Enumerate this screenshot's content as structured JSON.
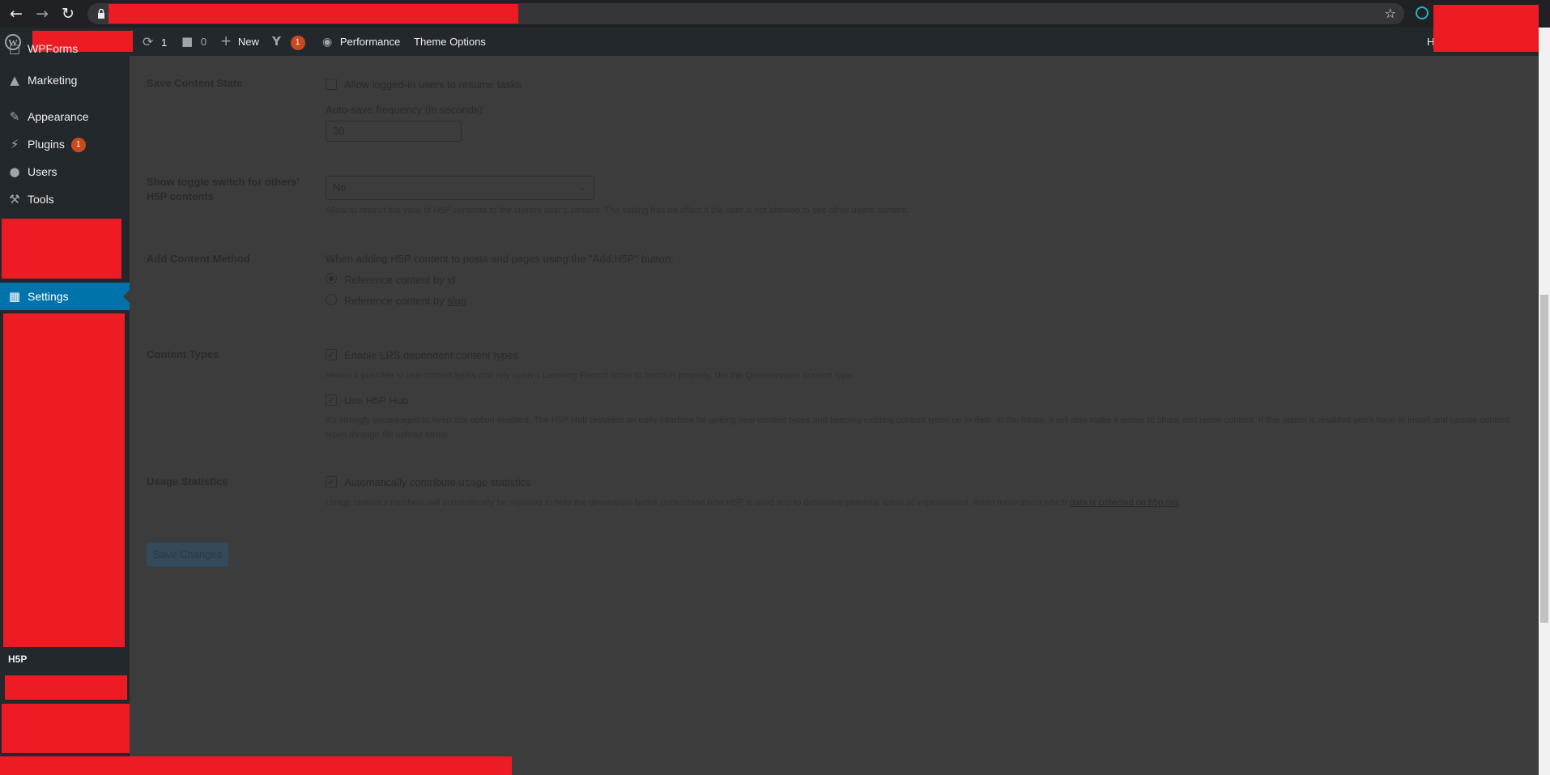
{
  "adminbar": {
    "updates_count": "1",
    "comments_count": "0",
    "new_label": "New",
    "yoast_badge": "1",
    "performance_label": "Performance",
    "theme_options_label": "Theme Options",
    "howdy_partial": "H"
  },
  "sidebar": {
    "items": [
      {
        "label": "WPForms"
      },
      {
        "label": "Marketing"
      },
      {
        "label": "Appearance"
      },
      {
        "label": "Plugins",
        "badge": "1"
      },
      {
        "label": "Users"
      },
      {
        "label": "Tools"
      },
      {
        "label": "Settings"
      },
      {
        "label": "H5P"
      }
    ]
  },
  "settings": {
    "save_state": {
      "label": "Save Content State",
      "checkbox_label": "Allow logged-in users to resume tasks",
      "autosave_label": "Auto-save frequency (in seconds):",
      "autosave_value": "30"
    },
    "toggle_switch": {
      "label": "Show toggle switch for others' H5P contents",
      "select_value": "No",
      "description": "Allow to restrict the view of H5P contents to the current user's content. The setting has no effect if the user is not allowed to see other users' content."
    },
    "content_method": {
      "label": "Add Content Method",
      "intro": "When adding H5P content to posts and pages using the \"Add H5P\" button:",
      "option_id": "Reference content by id",
      "option_slug_prefix": "Reference content by ",
      "option_slug_link": "slug"
    },
    "content_types": {
      "label": "Content Types",
      "lrs_label": "Enable LRS dependent content types",
      "lrs_description": "Makes it possible to use content types that rely upon a Learning Record Store to function properly, like the Questionnaire content type.",
      "hub_label": "Use H5P Hub",
      "hub_description": "It's strongly encouraged to keep this option enabled. The H5P Hub provides an easy interface for getting new content types and keeping existing content types up to date. In the future, it will also make it easier to share and reuse content. If this option is disabled you'll have to install and update content types through file upload forms."
    },
    "usage_stats": {
      "label": "Usage Statistics",
      "checkbox_label": "Automatically contribute usage statistics",
      "description_prefix": "Usage statistics numbers will automatically be reported to help the developers better understand how H5P is used and to determine potential areas of improvement. Read more about which ",
      "description_link": "data is collected on h5p.org",
      "description_suffix": "."
    },
    "save_button": "Save Changes"
  }
}
